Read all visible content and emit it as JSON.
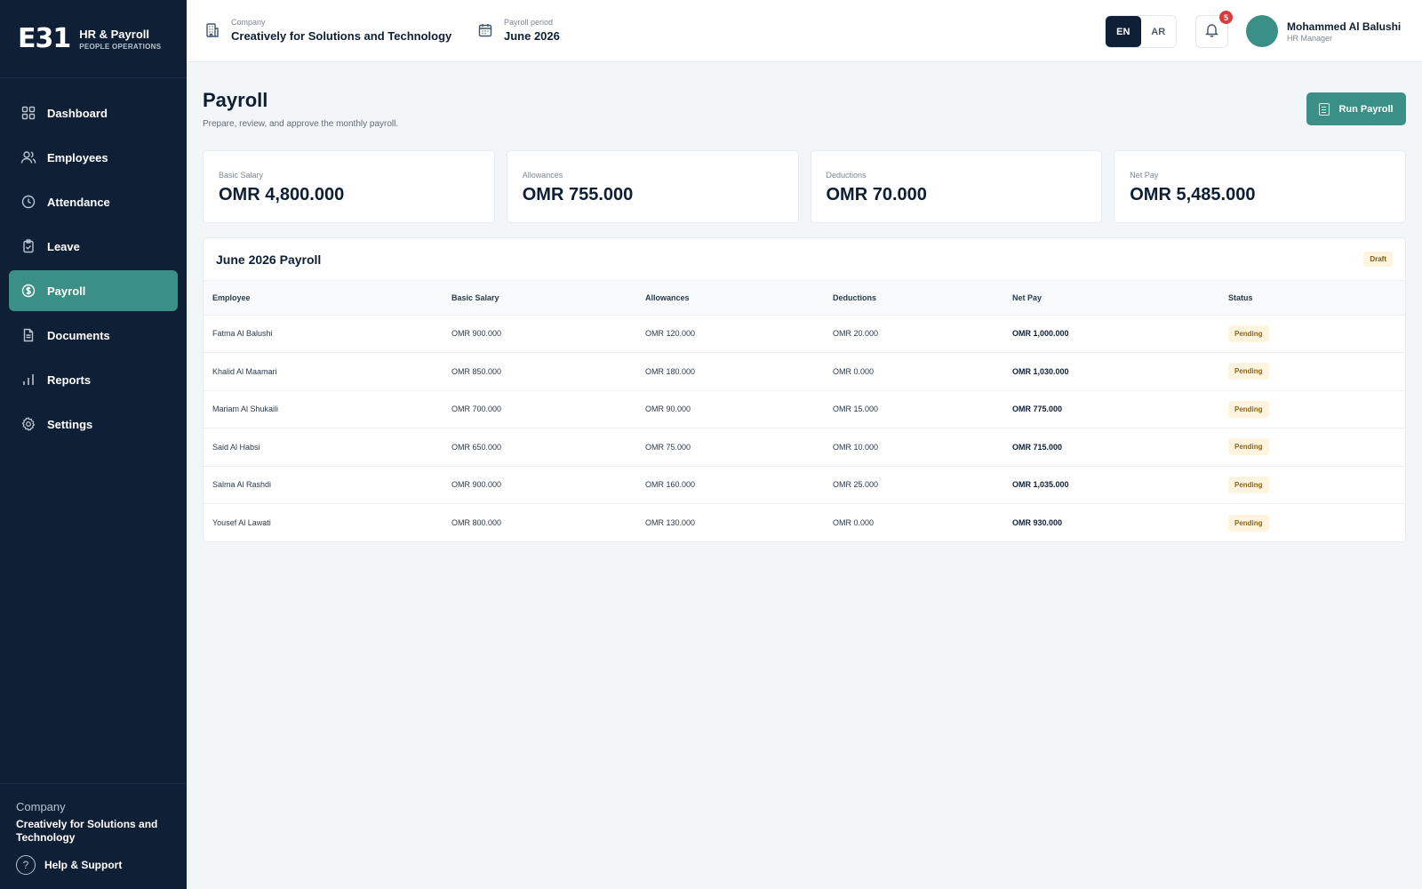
{
  "brand": {
    "logo": "E31",
    "name": "HR & Payroll",
    "subtitle": "PEOPLE OPERATIONS"
  },
  "sidebar": {
    "items": [
      {
        "label": "Dashboard",
        "icon": "dashboard-icon"
      },
      {
        "label": "Employees",
        "icon": "users-icon"
      },
      {
        "label": "Attendance",
        "icon": "clock-icon"
      },
      {
        "label": "Leave",
        "icon": "clipboard-icon"
      },
      {
        "label": "Payroll",
        "icon": "dollar-icon",
        "active": true
      },
      {
        "label": "Documents",
        "icon": "document-icon"
      },
      {
        "label": "Reports",
        "icon": "bar-chart-icon"
      },
      {
        "label": "Settings",
        "icon": "gear-icon"
      }
    ],
    "company_label": "Company",
    "company_name": "Creatively for Solutions and Technology",
    "help_label": "Help & Support"
  },
  "topbar": {
    "company_label": "Company",
    "company_name": "Creatively for Solutions and Technology",
    "period_label": "Payroll period",
    "period_value": "June 2026",
    "lang_en": "EN",
    "lang_ar": "AR",
    "notification_count": "5",
    "user_name": "Mohammed Al Balushi",
    "user_role": "HR Manager"
  },
  "page": {
    "title": "Payroll",
    "subtitle": "Prepare, review, and approve the monthly payroll.",
    "run_button": "Run Payroll"
  },
  "summary": [
    {
      "label": "Basic Salary",
      "value": "OMR 4,800.000"
    },
    {
      "label": "Allowances",
      "value": "OMR 755.000"
    },
    {
      "label": "Deductions",
      "value": "OMR 70.000"
    },
    {
      "label": "Net Pay",
      "value": "OMR 5,485.000"
    }
  ],
  "payroll_table": {
    "title": "June 2026 Payroll",
    "badge": "Draft",
    "columns": [
      "Employee",
      "Basic Salary",
      "Allowances",
      "Deductions",
      "Net Pay",
      "Status"
    ],
    "rows": [
      {
        "employee": "Fatma Al Balushi",
        "basic": "OMR 900.000",
        "allowances": "OMR 120.000",
        "deductions": "OMR 20.000",
        "net": "OMR 1,000.000",
        "status": "Pending"
      },
      {
        "employee": "Khalid Al Maamari",
        "basic": "OMR 850.000",
        "allowances": "OMR 180.000",
        "deductions": "OMR 0.000",
        "net": "OMR 1,030.000",
        "status": "Pending"
      },
      {
        "employee": "Mariam Al Shukaili",
        "basic": "OMR 700.000",
        "allowances": "OMR 90.000",
        "deductions": "OMR 15.000",
        "net": "OMR 775.000",
        "status": "Pending"
      },
      {
        "employee": "Said Al Habsi",
        "basic": "OMR 650.000",
        "allowances": "OMR 75.000",
        "deductions": "OMR 10.000",
        "net": "OMR 715.000",
        "status": "Pending"
      },
      {
        "employee": "Salma Al Rashdi",
        "basic": "OMR 900.000",
        "allowances": "OMR 160.000",
        "deductions": "OMR 25.000",
        "net": "OMR 1,035.000",
        "status": "Pending"
      },
      {
        "employee": "Yousef Al Lawati",
        "basic": "OMR 800.000",
        "allowances": "OMR 130.000",
        "deductions": "OMR 0.000",
        "net": "OMR 930.000",
        "status": "Pending"
      }
    ]
  },
  "colors": {
    "sidebar": "#0f1f36",
    "accent": "#3a8f86",
    "badge_bg": "#fff4de",
    "alert": "#dc3b3b"
  }
}
